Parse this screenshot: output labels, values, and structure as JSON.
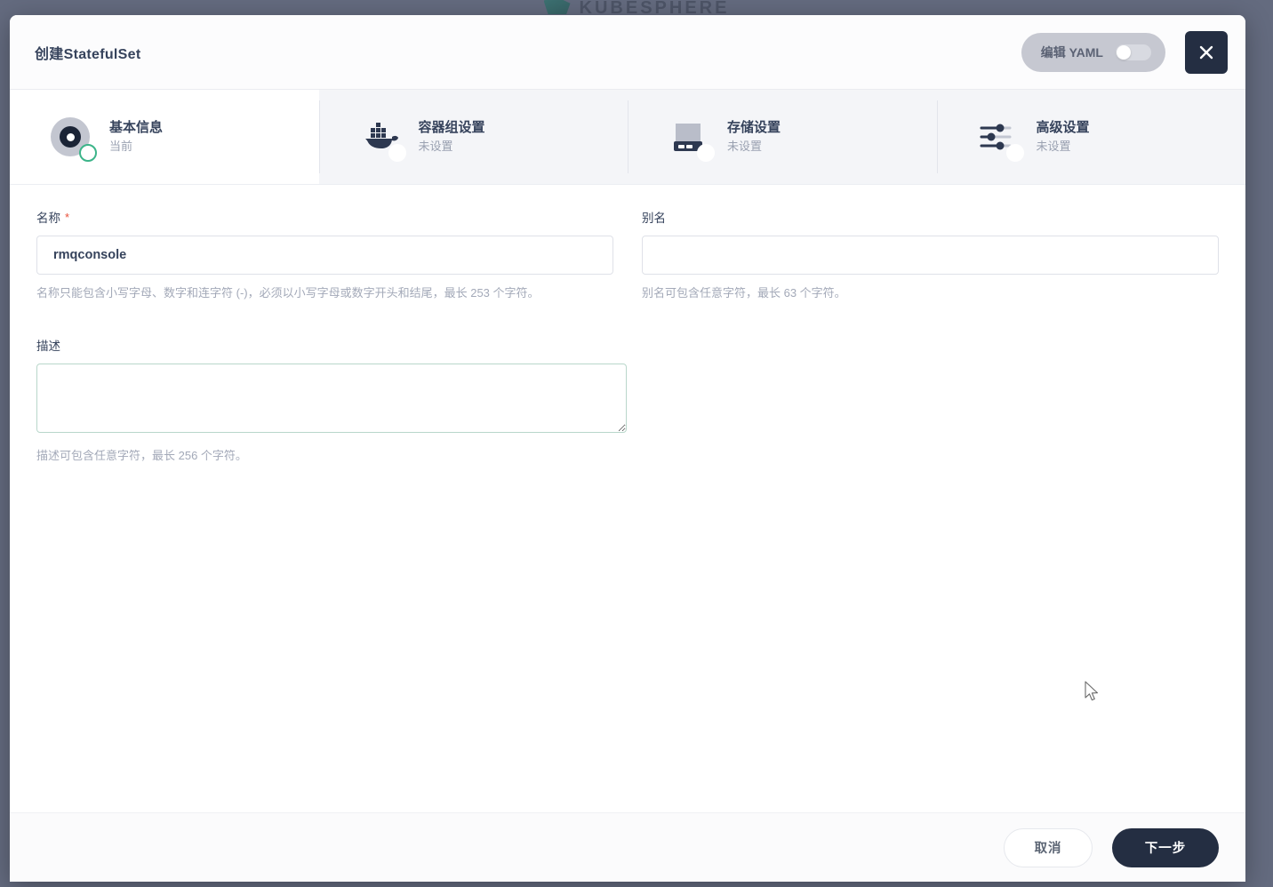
{
  "backdrop": {
    "brand_name": "KUBESPHERE",
    "brand_icon": "kubesphere-logo-icon"
  },
  "modal": {
    "title": "创建StatefulSet",
    "yaml_toggle": {
      "label": "编辑 YAML",
      "state": "off"
    },
    "close_label": "×",
    "close_icon": "close-icon"
  },
  "steps": [
    {
      "title": "基本信息",
      "status": "当前",
      "icon": "basic-info-dot-icon",
      "active": true
    },
    {
      "title": "容器组设置",
      "status": "未设置",
      "icon": "docker-whale-icon",
      "active": false
    },
    {
      "title": "存储设置",
      "status": "未设置",
      "icon": "storage-disk-icon",
      "active": false
    },
    {
      "title": "高级设置",
      "status": "未设置",
      "icon": "sliders-icon",
      "active": false
    }
  ],
  "form": {
    "name": {
      "label": "名称",
      "required_marker": "*",
      "value": "rmqconsole",
      "placeholder": "",
      "helper": "名称只能包含小写字母、数字和连字符 (-)，必须以小写字母或数字开头和结尾，最长 253 个字符。"
    },
    "alias": {
      "label": "别名",
      "value": "",
      "placeholder": "",
      "helper": "别名可包含任意字符，最长 63 个字符。"
    },
    "description": {
      "label": "描述",
      "value": "",
      "placeholder": "",
      "helper": "描述可包含任意字符，最长 256 个字符。"
    }
  },
  "footer": {
    "cancel_label": "取消",
    "next_label": "下一步"
  },
  "colors": {
    "accent_dark": "#242e42",
    "success_green": "#3cb489",
    "required_red": "#e8503a",
    "backdrop": "#646b7f"
  }
}
